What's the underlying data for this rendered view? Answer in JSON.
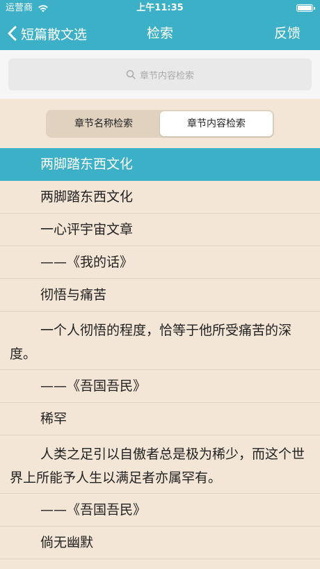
{
  "status_bar": {
    "carrier": "运营商",
    "time": "上午11:35"
  },
  "nav": {
    "back_label": "短篇散文选",
    "title": "检索",
    "feedback_label": "反馈"
  },
  "search": {
    "placeholder": "章节内容检索"
  },
  "segment": {
    "options": [
      "章节名称检索",
      "章节内容检索"
    ],
    "selected_index": 1
  },
  "list": {
    "highlight": "两脚踏东西文化",
    "items": [
      {
        "text": "两脚踏东西文化"
      },
      {
        "text": "一心评宇宙文章"
      },
      {
        "text": "——《我的话》"
      },
      {
        "text": "彻悟与痛苦"
      },
      {
        "text": "一个人彻悟的程度，恰等于他所受痛苦的深度。"
      },
      {
        "text": "——《吾国吾民》"
      },
      {
        "text": "稀罕"
      },
      {
        "text": "人类之足引以自傲者总是极为稀少，而这个世界上所能予人生以满足者亦属罕有。"
      },
      {
        "text": "——《吾国吾民》"
      },
      {
        "text": "倘无幽默"
      }
    ]
  },
  "colors": {
    "accent": "#3cb0c6",
    "background": "#f3e6d6"
  }
}
